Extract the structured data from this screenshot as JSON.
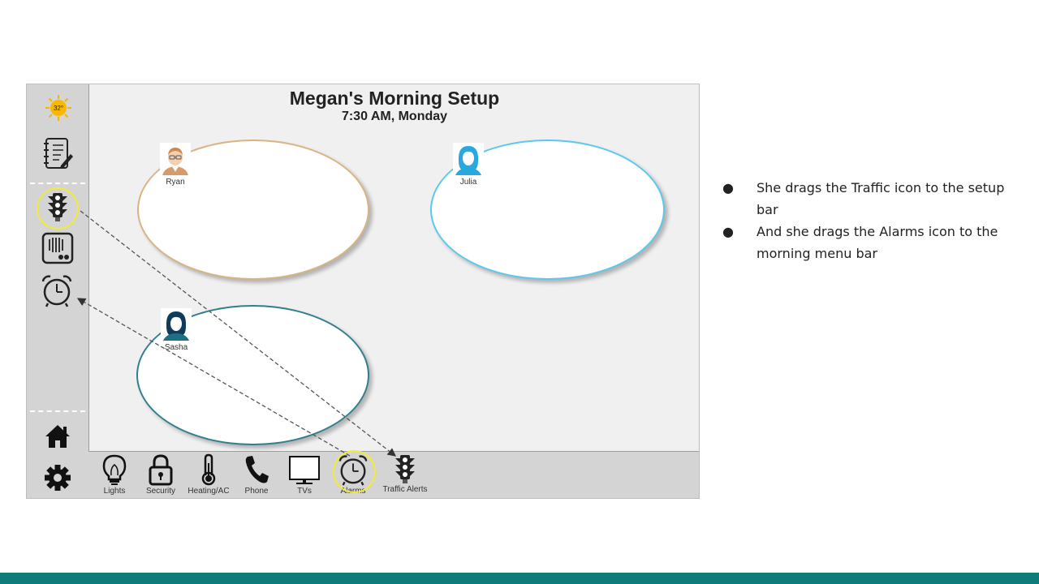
{
  "screen": {
    "title": "Megan's Morning Setup",
    "subtitle": "7:30 AM, Monday"
  },
  "sidebar": {
    "weather": {
      "value": "32°",
      "icon": "sun-icon"
    },
    "items": [
      {
        "icon": "notepad-icon"
      },
      {
        "icon": "traffic-light-icon"
      },
      {
        "icon": "speaker-icon"
      },
      {
        "icon": "alarm-clock-icon"
      }
    ],
    "bottom": [
      {
        "icon": "home-icon"
      },
      {
        "icon": "gear-icon"
      }
    ]
  },
  "people": [
    {
      "name": "Ryan",
      "color": "#d9b382",
      "avatar": "man-glasses-avatar"
    },
    {
      "name": "Julia",
      "color": "#5bc8ee",
      "avatar": "woman-avatar"
    },
    {
      "name": "Sasha",
      "color": "#2f7f8e",
      "avatar": "woman-avatar"
    }
  ],
  "toolbar": {
    "items": [
      {
        "label": "Lights",
        "icon": "lightbulb-icon"
      },
      {
        "label": "Security",
        "icon": "padlock-icon"
      },
      {
        "label": "Heating/AC",
        "icon": "thermometer-icon"
      },
      {
        "label": "Phone",
        "icon": "phone-icon"
      },
      {
        "label": "TVs",
        "icon": "tv-icon"
      },
      {
        "label": "Alarms",
        "icon": "alarm-clock-icon"
      },
      {
        "label": "Traffic Alerts",
        "icon": "traffic-light-icon"
      }
    ]
  },
  "notes": [
    "She drags the Traffic icon to the setup bar",
    "And she drags the Alarms icon to the morning menu bar"
  ],
  "colors": {
    "highlight": "#f2ea3c",
    "footer": "#0e7c78",
    "panel": "#d4d4d4",
    "canvas": "#f0f0f0"
  }
}
